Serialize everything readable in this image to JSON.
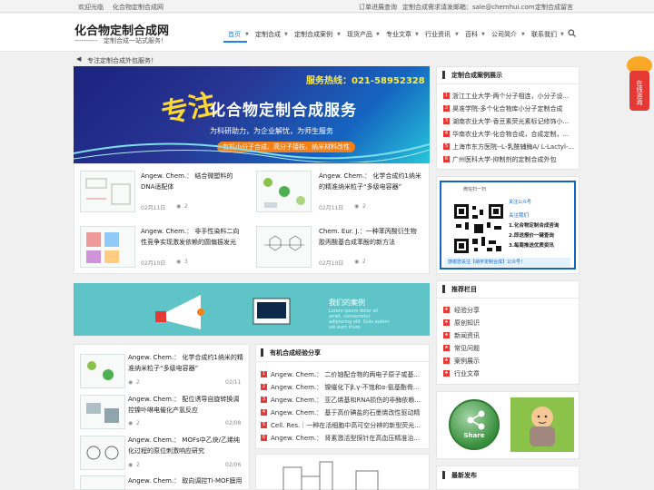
{
  "topbar": {
    "welcome": "欢迎光临",
    "site": "化合物定制合成网",
    "track": "订单进展查询",
    "email": "定制合成需求请发邮箱：sale@chemhui.com",
    "msg": "定制合成留言"
  },
  "logo": {
    "title": "化合物定制合成网",
    "dashes": "----------",
    "slogan": "定制合成一站式服务！"
  },
  "nav": [
    "首页",
    "定制合成",
    "定制合成案例",
    "现货产品",
    "专业文章",
    "行业资讯",
    "百科",
    "公司简介",
    "联系我们"
  ],
  "notice": "专注定制合成外包服务！",
  "banner": {
    "hotline": "服务热线：021-58952328",
    "zhu": "专注",
    "main": "化合物定制合成服务",
    "line2": "为科研助力，为企业解忧，为师生服务",
    "line3": "有机小分子合成、高分子接枝、纳米材料改性"
  },
  "posts": [
    {
      "title": "Angew. Chem.： 结合微塑料的DNA适配体",
      "date": "02月11日",
      "views": "2"
    },
    {
      "title": "Angew. Chem.： 化学合成约1纳米的精准纳米粒子“多级电容器”",
      "date": "02月11日",
      "views": "2"
    },
    {
      "title": "Angew. Chem.： 非手性染料二向性竞争实现激发依赖的圆偏振发光",
      "date": "02月10日",
      "views": "3"
    },
    {
      "title": "Chem. Eur. J.：一种苯丙酸衍生物胶丙酸基合成苯酚的新方法",
      "date": "02月10日",
      "views": "2"
    }
  ],
  "promo": {
    "title": "我们的案例",
    "sub": "Lorem ipsum dolor sit amet, consectetur adipiscing elit. Duis autem vel eum iriure"
  },
  "list": [
    {
      "title": "Angew. Chem.： 化学合成约1纳米的精准纳米粒子“多级电容器”",
      "views": "2",
      "date": "02/11"
    },
    {
      "title": "Angew. Chem.： 配位诱导自旋转换调控镍卟啉电催化产氢反应",
      "views": "2",
      "date": "02/08"
    },
    {
      "title": "Angew. Chem.： MOFs中乙炔/乙烯纯化过程的原位刺激响应研究",
      "views": "2",
      "date": "02/06"
    },
    {
      "title": "Angew. Chem.： 取向调控Ti-MOF膜用",
      "views": "",
      "date": ""
    }
  ],
  "organic": {
    "title": "有机合成经验分享",
    "items": [
      "Angew. Chem.： 二价铀配合物的两电子原子或基...",
      "Angew. Chem.： 镍催化下β,γ-不饱和α-氨基酯骨...",
      "Angew. Chem.： 亚乙烯基和RNA损伤的非酶依赖...",
      "Angew. Chem.： 基于高价碘盐的石墨烯改性驱动精...",
      "Cell. Res.｜一种在活细胞中高可空分辨的新型荧光...",
      "Angew. Chem.： 肾素激活型探针在高血压精准治..."
    ]
  },
  "cases": {
    "title": "定制合成案例展示",
    "items": [
      "浙江工业大学-两个分子相连，小分子设...",
      "昊准学院-多个化合物库小分子定制合成",
      "湖南农业大学-香豆素荧光素标记修饰小...",
      "华南农业大学-化合物合成，合成定制，...",
      "上海市东方医院--L-乳酰辅酶A/ L-Lactyl-...",
      "广州医科大学-抑制剂的定制合成外包"
    ]
  },
  "wechat": {
    "top": "微信扫一扫",
    "top2": "关注公众号",
    "follow": "关注我们",
    "l1": "1.化合物定制合成咨询",
    "l2": "2.即送报价一键查询",
    "l3": "3.每周推送优质资讯",
    "bottom": "感谢您关注【纳宇定制合成】公众号！"
  },
  "recommend": {
    "title": "推荐栏目",
    "items": [
      "经验分享",
      "原创知识",
      "新闻资讯",
      "常见问题",
      "案例展示",
      "行业文章"
    ]
  },
  "share": {
    "label": "Share"
  },
  "latest": {
    "title": "最新发布"
  },
  "float": {
    "label": "在线咨询"
  }
}
